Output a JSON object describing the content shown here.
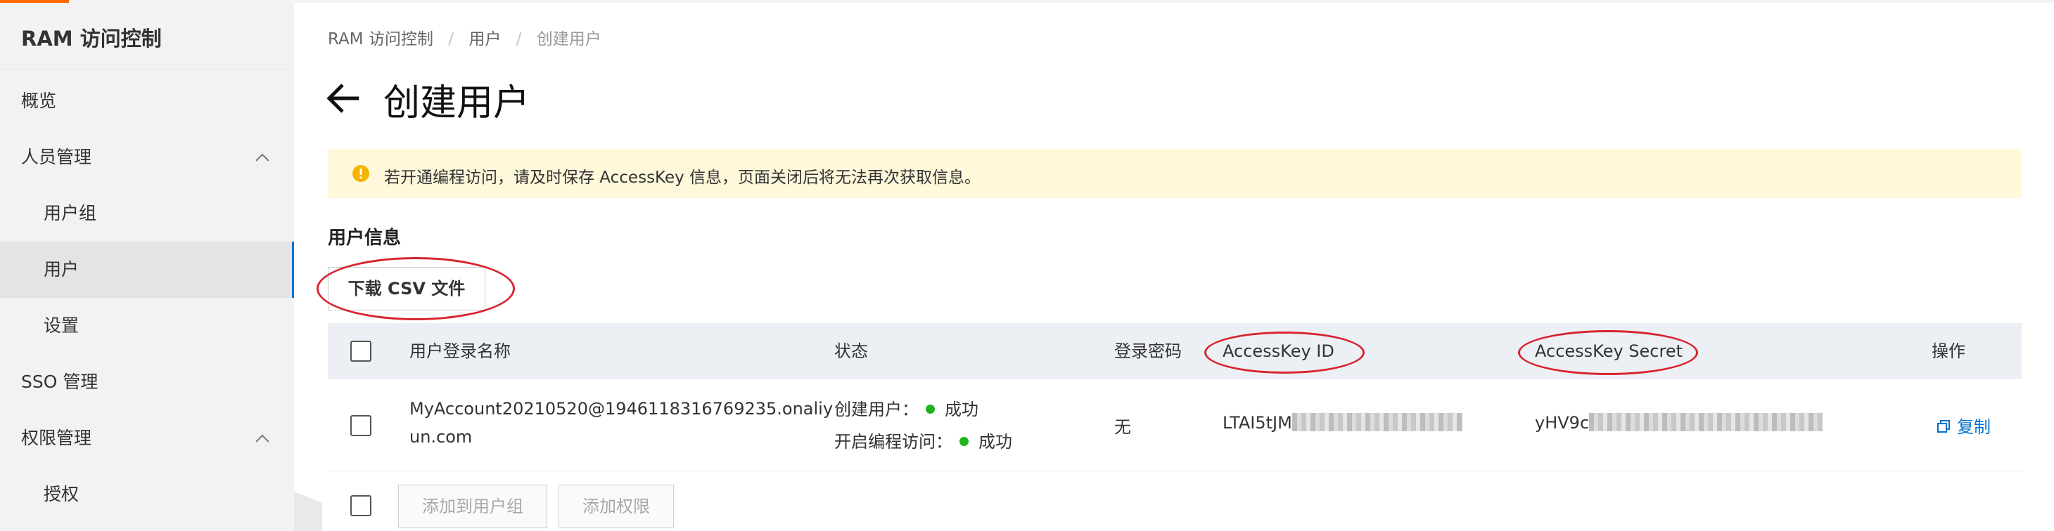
{
  "sidebar": {
    "title": "RAM 访问控制",
    "items": [
      {
        "label": "概览"
      },
      {
        "label": "人员管理"
      },
      {
        "label": "用户组"
      },
      {
        "label": "用户"
      },
      {
        "label": "设置"
      },
      {
        "label": "SSO 管理"
      },
      {
        "label": "权限管理"
      },
      {
        "label": "授权"
      }
    ]
  },
  "breadcrumb": {
    "items": [
      "RAM 访问控制",
      "用户",
      "创建用户"
    ],
    "separator": "/"
  },
  "page": {
    "title": "创建用户"
  },
  "alert": {
    "text": "若开通编程访问，请及时保存 AccessKey 信息，页面关闭后将无法再次获取信息。",
    "color": "#fff8db"
  },
  "section": {
    "title": "用户信息"
  },
  "toolbar": {
    "download_csv_label": "下载 CSV 文件"
  },
  "table": {
    "columns": [
      "用户登录名称",
      "状态",
      "登录密码",
      "AccessKey ID",
      "AccessKey Secret",
      "操作"
    ],
    "rows": [
      {
        "login_name_line1": "MyAccount20210520@1946118316769235.onaliy",
        "login_name_line2": "un.com",
        "status_create_label": "创建用户：",
        "status_create_value": "成功",
        "status_api_label": "开启编程访问：",
        "status_api_value": "成功",
        "password": "无",
        "access_key_id": "LTAI5tJM",
        "access_key_secret": "yHV9c",
        "action": "复制"
      }
    ]
  },
  "footer": {
    "add_to_group_label": "添加到用户组",
    "add_permission_label": "添加权限"
  },
  "colors": {
    "accent": "#ff6a00",
    "link": "#0070cc",
    "success": "#1fb41f",
    "annotation": "#d9232d"
  }
}
